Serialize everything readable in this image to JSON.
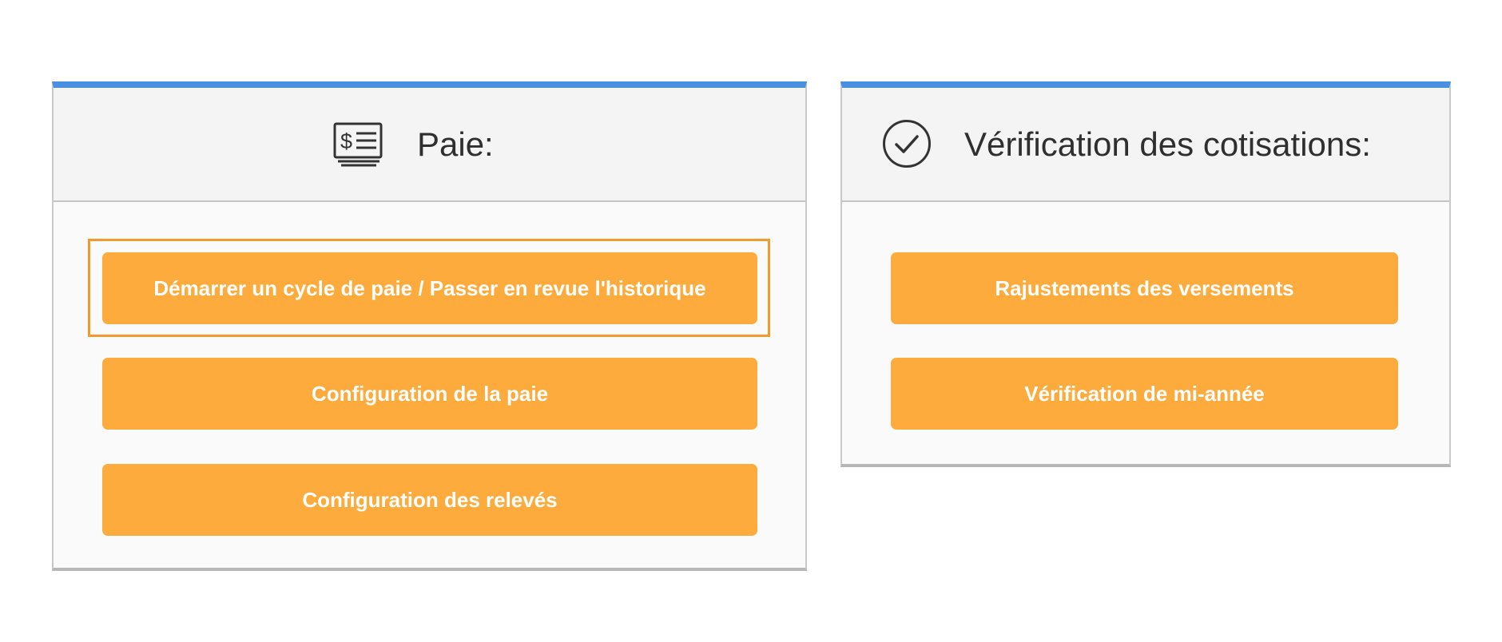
{
  "colors": {
    "accent_top": "#4a90e2",
    "button": "#fcab3c",
    "button_text": "#ffffff",
    "focus_outline": "#f29a2e"
  },
  "paie": {
    "icon": "payroll-check-icon",
    "title": "Paie:",
    "buttons": [
      {
        "label": "Démarrer un cycle de paie / Passer en revue l'historique",
        "focused": true
      },
      {
        "label": "Configuration de la paie"
      },
      {
        "label": "Configuration des relevés"
      }
    ]
  },
  "verification": {
    "icon": "checkmark-circle-icon",
    "title": "Vérification des cotisations:",
    "buttons": [
      {
        "label": "Rajustements des versements"
      },
      {
        "label": "Vérification de mi-année"
      }
    ]
  }
}
